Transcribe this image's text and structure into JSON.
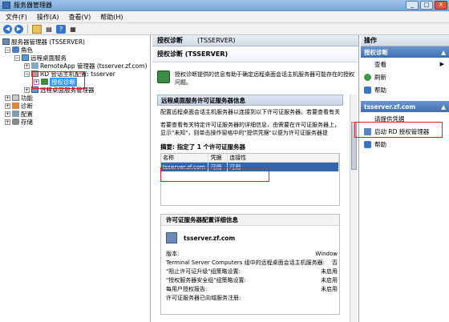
{
  "window": {
    "title": "服务器管理器"
  },
  "window_buttons": [
    "_",
    "□",
    "X"
  ],
  "menu": [
    "文件(F)",
    "操作(A)",
    "查看(V)",
    "帮助(H)"
  ],
  "tree": {
    "root": "服务器管理器 (TSSERVER)",
    "roles": "角色",
    "rds": "远程桌面服务",
    "remoteapp": "RemoteApp 管理器 (tsserver.zf.com)",
    "rd_config": "RD 会话主机配置: tsserver",
    "license_diag": "授权诊断",
    "rd_manager": "远程桌面服务管理器",
    "features": "功能",
    "diagnostics": "诊断",
    "configuration": "配置",
    "storage": "存储"
  },
  "middle": {
    "header_title": "授权诊断",
    "header_sub": "(TSSERVER)",
    "title": "授权诊断 (TSSERVER)",
    "intro": "授权诊断提供的信息有助于确定远程桌面会话主机服务器可能存在的授权问题。",
    "section1": "远程桌面服务许可证服务器信息",
    "para1": "配置远程桌面会话主机服务器以连接到以下许可证服务器。若要查看有关",
    "para2": "若要查看有关特定许可证服务器的详细信息，由需要在许可证服务器上，显示\"未知\"，则单击操作窗格中的\"提供凭据\"以便为许可证服务器提",
    "summary": "摘要: 指定了 1 个许可证服务器",
    "columns": [
      "名称",
      "凭据",
      "连接性"
    ],
    "rows": [
      {
        "name": "tsserver.zf.com",
        "cred": "可用",
        "conn": "可用"
      }
    ],
    "detail_title": "许可证服务器配置详细信息",
    "detail_host": "tsserver.zf.com",
    "details": [
      {
        "k": "版本:",
        "v": "Window"
      },
      {
        "k": "Terminal Server Computers 组中的远程桌面会话主机服务器:",
        "v": "否"
      },
      {
        "k": "\"阻止许可证升级\"组策略设置:",
        "v": "未启用"
      },
      {
        "k": "\"授权服务器安全组\"组策略设置:",
        "v": "未启用"
      },
      {
        "k": "每用户授权报告:",
        "v": "未启用"
      },
      {
        "k": "许可证服务器已向域服务注册:",
        "v": ""
      }
    ]
  },
  "actions": {
    "header": "操作",
    "group1": "授权诊断",
    "view": "查看",
    "refresh": "刷新",
    "help1": "帮助",
    "group2": "tsserver.zf.com",
    "credentials": "请提供凭据",
    "start_manager": "启动 RD 授权管理器",
    "help2": "帮助"
  },
  "colors": {
    "highlight_box": "#e02020",
    "selection": "#3366aa"
  }
}
